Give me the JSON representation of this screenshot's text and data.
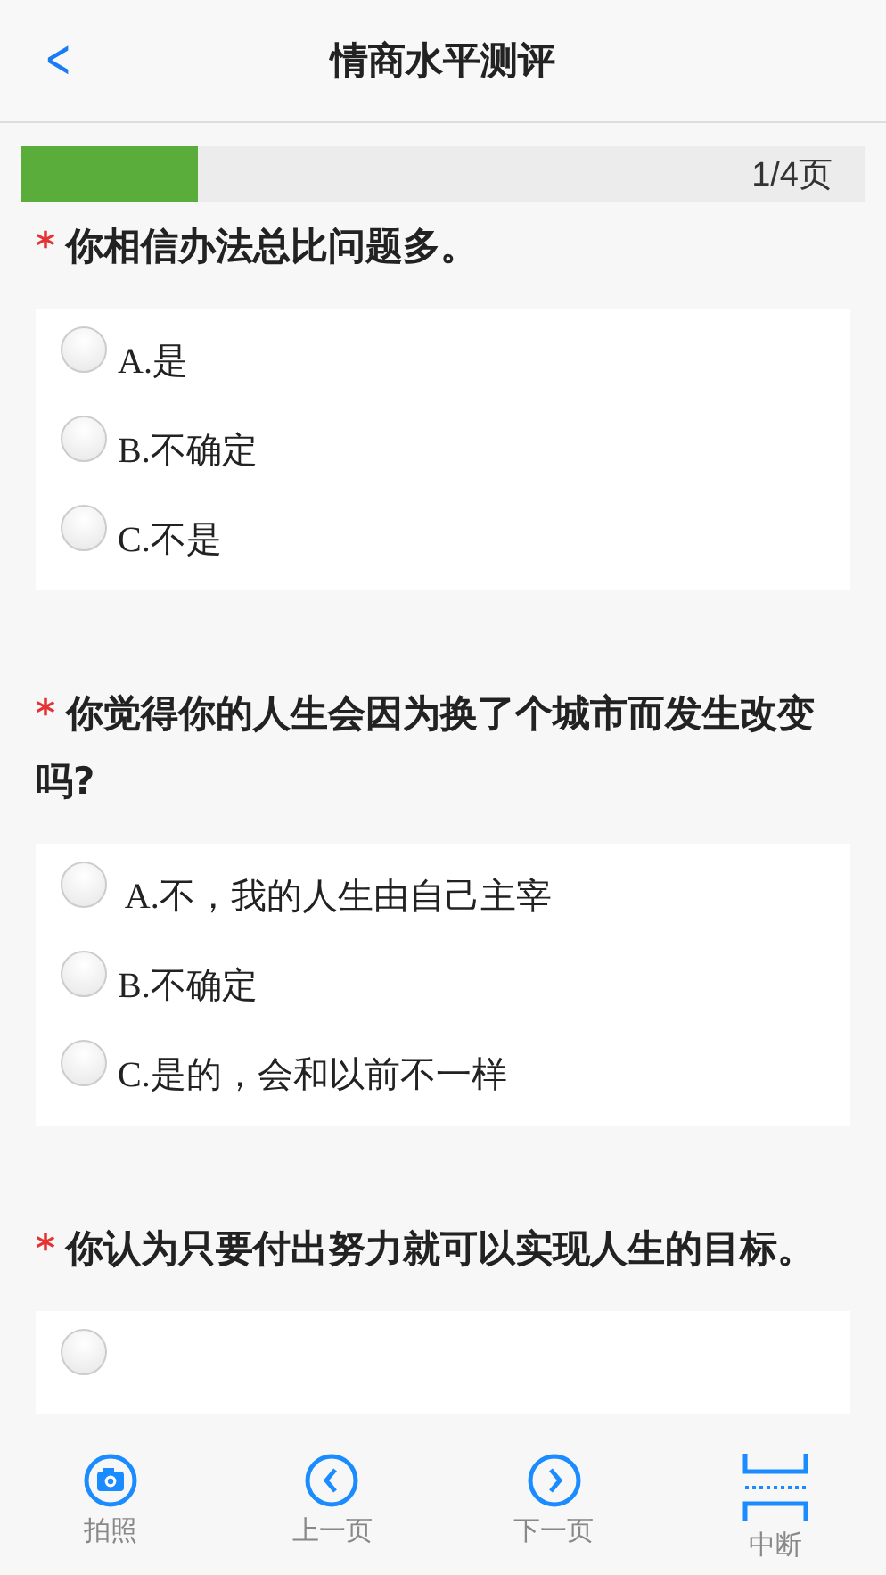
{
  "header": {
    "back": "<",
    "title": "情商水平测评"
  },
  "progress": {
    "level": 0.21,
    "label": "1/4页"
  },
  "questions": [
    {
      "required": true,
      "mark": "*",
      "text": "你相信办法总比问题多。",
      "options": [
        {
          "label": "A.是",
          "selected": false
        },
        {
          "label": "B.不确定",
          "selected": false
        },
        {
          "label": "C.不是",
          "selected": false
        }
      ]
    },
    {
      "required": true,
      "mark": "*",
      "text": "你觉得你的人生会因为换了个城市而发生改变吗?",
      "options": [
        {
          "label": " A.不，我的人生由自己主宰",
          "selected": false
        },
        {
          "label": "B.不确定",
          "selected": false
        },
        {
          "label": "C.是的，会和以前不一样",
          "selected": false
        }
      ]
    },
    {
      "required": true,
      "mark": "*",
      "text": "你认为只要付出努力就可以实现人生的目标。",
      "options": [
        {
          "selected": false
        }
      ]
    }
  ],
  "tabbar": [
    {
      "kind": "camera",
      "label": "拍照"
    },
    {
      "kind": "prev",
      "label": "上一页"
    },
    {
      "kind": "next",
      "label": "下一页"
    },
    {
      "kind": "stop",
      "label": "中断"
    }
  ]
}
